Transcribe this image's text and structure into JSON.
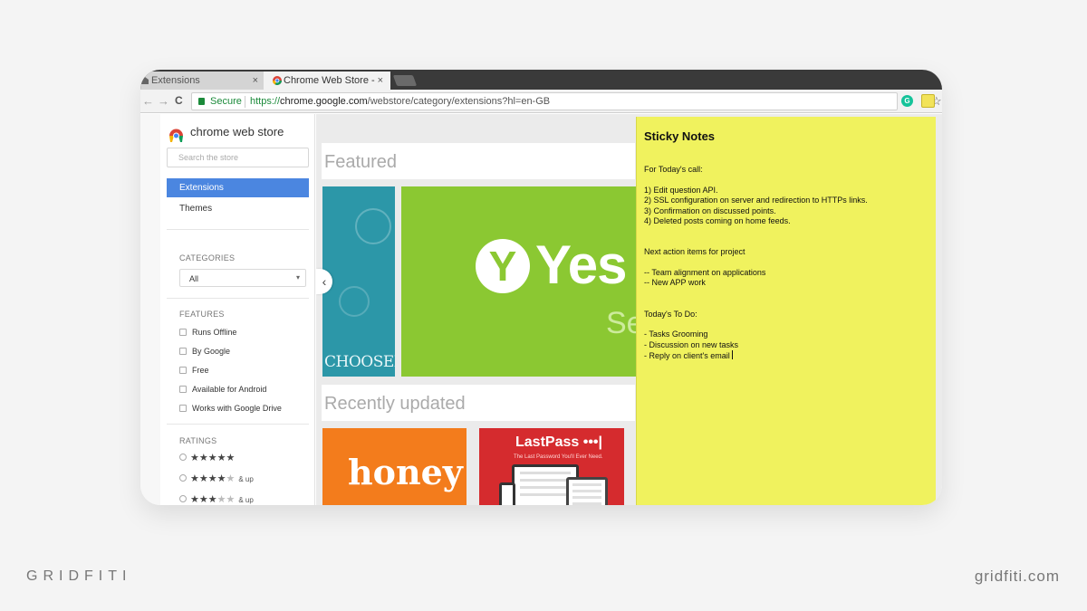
{
  "browser": {
    "tabs": [
      {
        "label": "Extensions",
        "icon": "puzzle-icon"
      },
      {
        "label": "Chrome Web Store -",
        "icon": "chrome-icon"
      }
    ],
    "close_glyph": "×",
    "secure_label": "Secure",
    "url_scheme": "https://",
    "url_host": "chrome.google.com",
    "url_path": "/webstore/category/extensions?hl=en-GB",
    "nav_back": "←",
    "nav_forward": "→",
    "nav_reload": "C",
    "star_glyph": "☆",
    "ext_g_label": "G"
  },
  "sidebar": {
    "store_name": "chrome web store",
    "search_placeholder": "Search the store",
    "nav": {
      "extensions": "Extensions",
      "themes": "Themes"
    },
    "categories_label": "CATEGORIES",
    "category_selected": "All",
    "features_label": "FEATURES",
    "features": [
      "Runs Offline",
      "By Google",
      "Free",
      "Available for Android",
      "Works with Google Drive"
    ],
    "ratings_label": "RATINGS",
    "ratings": [
      {
        "filled": "★★★★★",
        "empty": "",
        "suffix": ""
      },
      {
        "filled": "★★★★",
        "empty": "★",
        "suffix": "& up"
      },
      {
        "filled": "★★★",
        "empty": "★★",
        "suffix": "& up"
      }
    ]
  },
  "main": {
    "featured_title": "Featured",
    "recent_title": "Recently updated",
    "tile_teal_brand": "CHOOSEKIND",
    "tile_yes_mark": "Y",
    "tile_yes_text": "Yes",
    "tile_yes_sub": "Se",
    "tile_honey": "honey",
    "tile_lastpass": "LastPass •••|",
    "tile_lastpass_tag": "The Last Password You'll Ever Need.",
    "carousel_prev": "‹"
  },
  "sticky_note": {
    "title": "Sticky Notes",
    "lines": [
      "For Today's call:",
      "",
      "1) Edit question API.",
      "2) SSL configuration on server and redirection to HTTPs links.",
      "3) Confirmation on discussed points.",
      "4) Deleted posts coming on home feeds.",
      "",
      "",
      "Next action items for project",
      "",
      "-- Team alignment on applications",
      "-- New APP work",
      "",
      "",
      "Today's To Do:",
      "",
      "- Tasks Grooming",
      "- Discussion on new tasks",
      "- Reply on client's email"
    ]
  },
  "footer": {
    "left": "GRIDFITI",
    "right": "gridfiti.com"
  },
  "colors": {
    "sticky": "#f0f25e",
    "accent": "#4b86e0",
    "secure": "#1b8a3a"
  }
}
